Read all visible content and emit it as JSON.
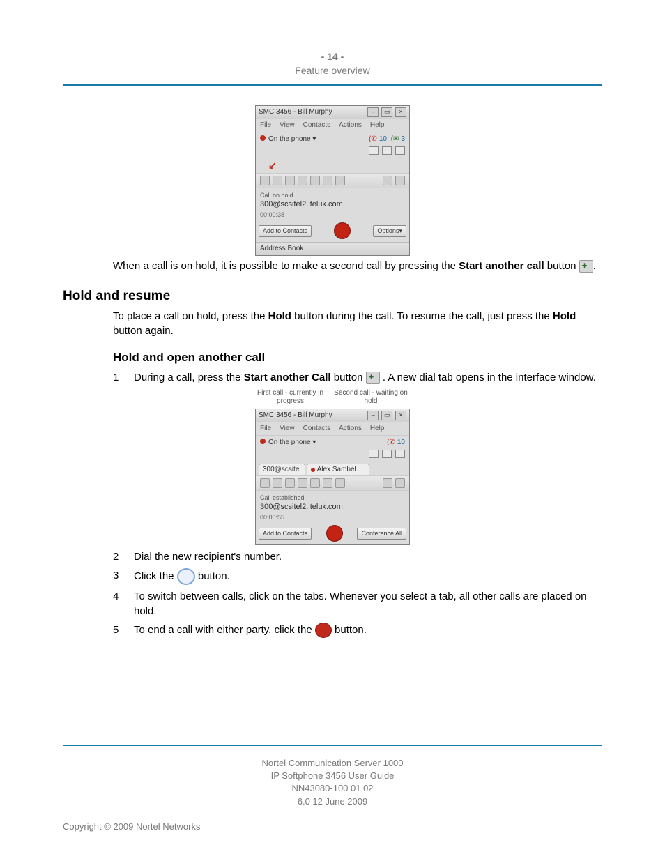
{
  "header": {
    "page_number": "- 14 -",
    "section": "Feature overview"
  },
  "screenshot1": {
    "title": "SMC 3456 - Bill Murphy",
    "menus": {
      "file": "File",
      "view": "View",
      "contacts": "Contacts",
      "actions": "Actions",
      "help": "Help"
    },
    "presence": "On the phone",
    "counters": {
      "missed": "10",
      "vm": "3"
    },
    "call_status": "Call on hold",
    "sip": "300@scsitel2.iteluk.com",
    "duration": "00:00:38",
    "add_contacts": "Add to Contacts",
    "options": "Options",
    "address_book": "Address Book"
  },
  "para1": {
    "p1a": "When a call is on hold, it is possible to make a second call by pressing the ",
    "p1b_bold": "Start another call",
    "p1c": " button ",
    "p1d": "."
  },
  "h2_hold_resume": "Hold and resume",
  "para2": {
    "a": "To place a call on hold, press the ",
    "b_bold": "Hold",
    "c": " button during the call. To resume the call, just press the ",
    "d_bold": "Hold",
    "e": " button again."
  },
  "h3_hold_open": "Hold and open another call",
  "step1": {
    "num": "1",
    "a": "During a call, press the ",
    "b_bold": "Start another Call",
    "c": " button ",
    "d": " . A new dial tab opens in the interface window."
  },
  "labels": {
    "first": "First call - currently in progress",
    "second": "Second call - waiting on hold"
  },
  "screenshot2": {
    "title": "SMC 3456 - Bill Murphy",
    "menus": {
      "file": "File",
      "view": "View",
      "contacts": "Contacts",
      "actions": "Actions",
      "help": "Help"
    },
    "presence": "On the phone",
    "counters": {
      "missed": "10"
    },
    "tab1": "300@scsitel",
    "tab2": "Alex Sambel",
    "call_status": "Call established",
    "sip": "300@scsitel2.iteluk.com",
    "duration": "00:00:55",
    "add_contacts": "Add to Contacts",
    "conference": "Conference All"
  },
  "step2": {
    "num": "2",
    "txt": "Dial the new recipient's number."
  },
  "step3": {
    "num": "3",
    "a": "Click the ",
    "b": " button."
  },
  "step4": {
    "num": "4",
    "txt": "To switch between calls, click on the tabs. Whenever you select a tab, all other calls are placed on hold."
  },
  "step5": {
    "num": "5",
    "a": "To end a call with either party, click the ",
    "b": " button."
  },
  "footer": {
    "l1": "Nortel Communication Server 1000",
    "l2": "IP Softphone 3456 User Guide",
    "l3": "NN43080-100   01.02",
    "l4": "6.0   12 June 2009"
  },
  "copyright": "Copyright © 2009 Nortel Networks"
}
